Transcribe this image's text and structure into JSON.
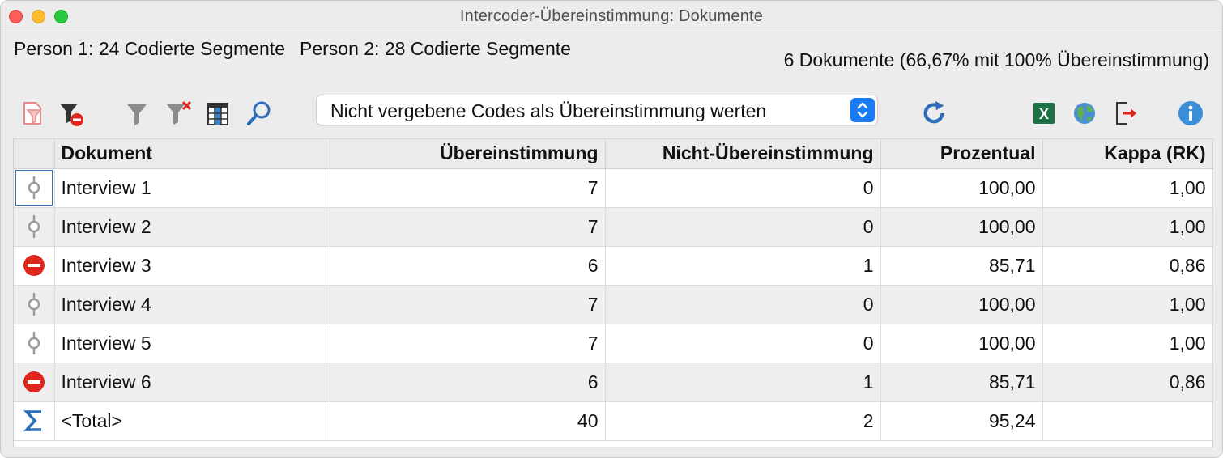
{
  "window": {
    "title": "Intercoder-Übereinstimmung: Dokumente"
  },
  "info": {
    "person1": "Person 1: 24 Codierte Segmente",
    "person2": "Person 2: 28 Codierte Segmente",
    "summary": "6 Dokumente (66,67% mit 100% Übereinstimmung)"
  },
  "toolbar": {
    "dropdown_value": "Nicht vergebene Codes als Übereinstimmung werten",
    "icons": [
      "filter-doc-icon",
      "filter-remove-icon",
      "filter-icon",
      "filter-clear-icon",
      "columns-icon",
      "search-icon",
      "refresh-icon",
      "excel-export-icon",
      "web-export-icon",
      "export-icon",
      "info-icon"
    ],
    "accent": "#1a7cf5"
  },
  "table": {
    "columns": [
      "",
      "Dokument",
      "Übereinstimmung",
      "Nicht-Übereinstimmung",
      "Prozentual",
      "Kappa (RK)"
    ],
    "rows": [
      {
        "status": "match",
        "doc": "Interview 1",
        "agree": "7",
        "disagree": "0",
        "percent": "100,00",
        "kappa": "1,00"
      },
      {
        "status": "match",
        "doc": "Interview 2",
        "agree": "7",
        "disagree": "0",
        "percent": "100,00",
        "kappa": "1,00"
      },
      {
        "status": "mismatch",
        "doc": "Interview 3",
        "agree": "6",
        "disagree": "1",
        "percent": "85,71",
        "kappa": "0,86"
      },
      {
        "status": "match",
        "doc": "Interview 4",
        "agree": "7",
        "disagree": "0",
        "percent": "100,00",
        "kappa": "1,00"
      },
      {
        "status": "match",
        "doc": "Interview 5",
        "agree": "7",
        "disagree": "0",
        "percent": "100,00",
        "kappa": "1,00"
      },
      {
        "status": "mismatch",
        "doc": "Interview 6",
        "agree": "6",
        "disagree": "1",
        "percent": "85,71",
        "kappa": "0,86"
      }
    ],
    "total": {
      "doc": "<Total>",
      "agree": "40",
      "disagree": "2",
      "percent": "95,24",
      "kappa": ""
    }
  }
}
